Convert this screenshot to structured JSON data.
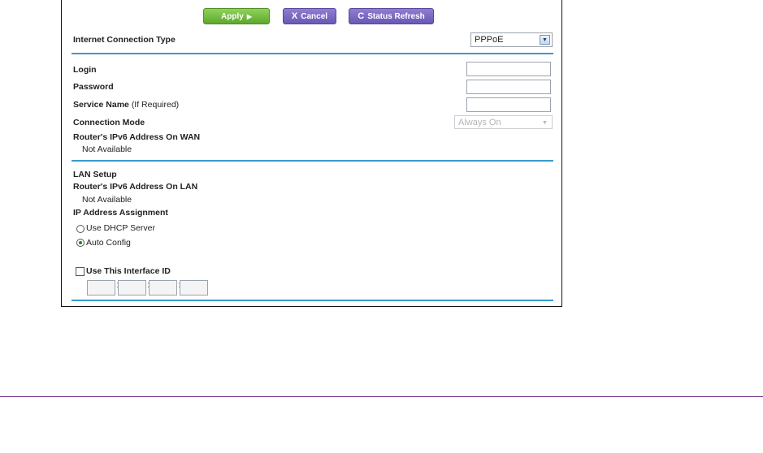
{
  "toolbar": {
    "apply_label": "Apply",
    "apply_icon": "▶",
    "cancel_icon": "X",
    "cancel_label": "Cancel",
    "refresh_icon": "C",
    "refresh_label": "Status Refresh"
  },
  "internet": {
    "connection_type_label": "Internet Connection Type",
    "connection_type_value": "PPPoE",
    "login_label": "Login",
    "login_value": "",
    "password_label": "Password",
    "password_value": "",
    "service_name_label": "Service Name",
    "service_name_hint": "(If Required)",
    "service_name_value": "",
    "connection_mode_label": "Connection Mode",
    "connection_mode_value": "Always On",
    "wan_ipv6_label": "Router's IPv6 Address On WAN",
    "wan_ipv6_value": "Not Available"
  },
  "lan": {
    "setup_label": "LAN Setup",
    "lan_ipv6_label": "Router's IPv6 Address On LAN",
    "lan_ipv6_value": "Not Available",
    "ip_assignment_label": "IP Address Assignment",
    "dhcp_option": "Use DHCP Server",
    "auto_config_option": "Auto Config",
    "selected_option": "Auto Config",
    "interface_id_label": "Use This Interface ID",
    "interface_id_checked": false,
    "interface_id_separator": ":"
  },
  "colors": {
    "apply_button": "#6cb83a",
    "purple_button": "#7866c3",
    "rule": "#3a9bd0",
    "bottom_rule": "#7a3d8a"
  }
}
